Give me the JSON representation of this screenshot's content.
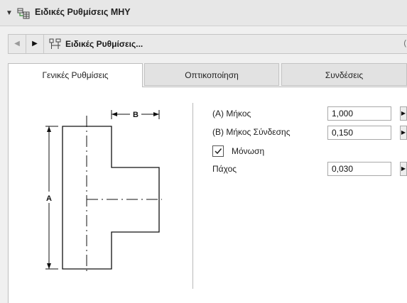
{
  "titlebar": {
    "collapse_glyph": "▼",
    "title": "Ειδικές Ρυθμίσεις ΜΗΥ",
    "icon": "settings-table-icon"
  },
  "navbar": {
    "prev_glyph": "◀",
    "next_glyph": "▶",
    "title": "Ειδικές Ρυθμίσεις...",
    "icon": "object-settings-icon",
    "end_glyph": "("
  },
  "tabs": [
    {
      "label": "Γενικές Ρυθμίσεις",
      "active": true
    },
    {
      "label": "Οπτικοποίηση",
      "active": false
    },
    {
      "label": "Συνδέσεις",
      "active": false
    }
  ],
  "diagram": {
    "label_a": "A",
    "label_b": "B"
  },
  "fields": {
    "length": {
      "label": "(A) Μήκος",
      "value": "1,000"
    },
    "connection_length": {
      "label": "(B) Μήκος Σύνδεσης",
      "value": "0,150"
    },
    "insulation": {
      "label": "Μόνωση",
      "checked": true,
      "check_glyph": "✓"
    },
    "thickness": {
      "label": "Πάχος",
      "value": "0,030"
    }
  },
  "spin_glyph": "▶",
  "colors": {
    "window_bg": "#f0f0f0",
    "panel_bg": "#ffffff",
    "border": "#bdbdbd"
  }
}
